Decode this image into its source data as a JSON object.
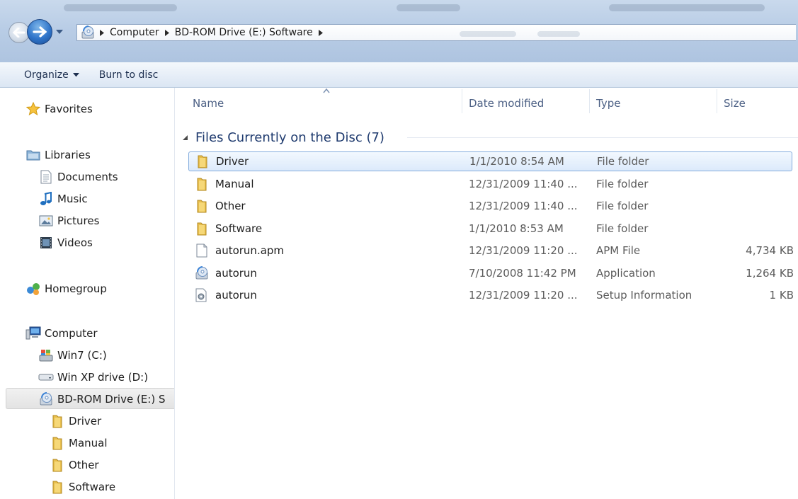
{
  "window": {
    "breadcrumbs": [
      "Computer",
      "BD-ROM Drive (E:) Software"
    ]
  },
  "toolbar": {
    "organize_label": "Organize",
    "burn_label": "Burn to disc"
  },
  "navigation": {
    "favorites": "Favorites",
    "libraries": "Libraries",
    "documents": "Documents",
    "music": "Music",
    "pictures": "Pictures",
    "videos": "Videos",
    "homegroup": "Homegroup",
    "computer": "Computer",
    "drive_c": "Win7 (C:)",
    "drive_d": "Win XP drive (D:)",
    "drive_e": "BD-ROM Drive (E:) S",
    "subfolders": [
      "Driver",
      "Manual",
      "Other",
      "Software"
    ]
  },
  "columns": {
    "name": "Name",
    "date": "Date modified",
    "type": "Type",
    "size": "Size"
  },
  "group": {
    "label": "Files Currently on the Disc (7)"
  },
  "files": [
    {
      "name": "Driver",
      "date": "1/1/2010 8:54 AM",
      "type": "File folder",
      "size": "",
      "icon": "folder-icon"
    },
    {
      "name": "Manual",
      "date": "12/31/2009 11:40 ...",
      "type": "File folder",
      "size": "",
      "icon": "folder-icon"
    },
    {
      "name": "Other",
      "date": "12/31/2009 11:40 ...",
      "type": "File folder",
      "size": "",
      "icon": "folder-icon"
    },
    {
      "name": "Software",
      "date": "1/1/2010 8:53 AM",
      "type": "File folder",
      "size": "",
      "icon": "folder-icon"
    },
    {
      "name": "autorun.apm",
      "date": "12/31/2009 11:20 ...",
      "type": "APM File",
      "size": "4,734 KB",
      "icon": "file-icon"
    },
    {
      "name": "autorun",
      "date": "7/10/2008 11:42 PM",
      "type": "Application",
      "size": "1,264 KB",
      "icon": "application-icon"
    },
    {
      "name": "autorun",
      "date": "12/31/2009 11:20 ...",
      "type": "Setup Information",
      "size": "1 KB",
      "icon": "setup-info-icon"
    }
  ],
  "colors": {
    "selection_border": "#84acdd",
    "group_header": "#1e3a6e",
    "column_header": "#4d6185"
  }
}
